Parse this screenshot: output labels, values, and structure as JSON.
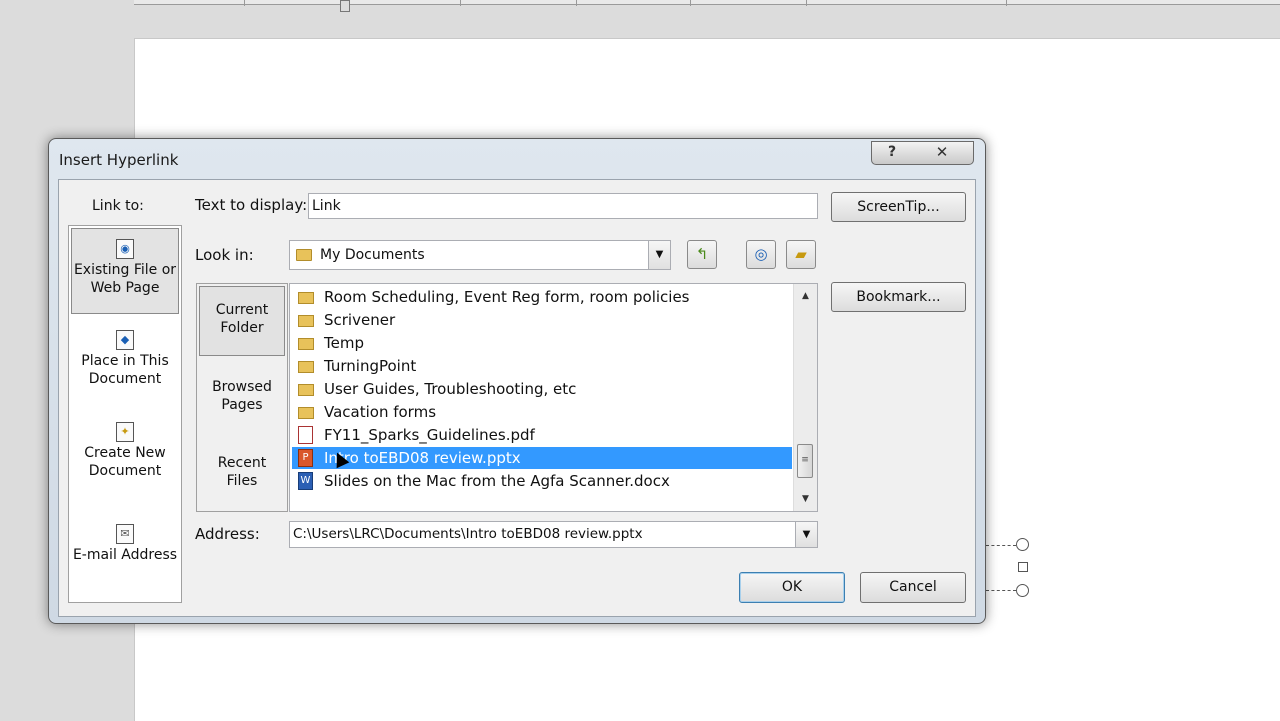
{
  "dialog": {
    "title": "Insert Hyperlink",
    "help_glyph": "?",
    "close_glyph": "✕"
  },
  "linkto": {
    "label": "Link to:",
    "items": [
      {
        "label_line1": "Existing File or",
        "label_line2": "Web Page"
      },
      {
        "label_line1": "Place in This",
        "label_line2": "Document"
      },
      {
        "label_line1": "Create New",
        "label_line2": "Document"
      },
      {
        "label_line1": "E-mail Address",
        "label_line2": ""
      }
    ]
  },
  "text_to_display": {
    "label": "Text to display:",
    "value": "Link"
  },
  "buttons": {
    "screentip": "ScreenTip...",
    "bookmark": "Bookmark...",
    "ok": "OK",
    "cancel": "Cancel"
  },
  "look_in": {
    "label": "Look in:",
    "value": "My Documents"
  },
  "nav": {
    "items": [
      {
        "line1": "Current",
        "line2": "Folder"
      },
      {
        "line1": "Browsed",
        "line2": "Pages"
      },
      {
        "line1": "Recent",
        "line2": "Files"
      }
    ]
  },
  "files": [
    {
      "name": "Room Scheduling, Event Reg form, room policies",
      "type": "folder"
    },
    {
      "name": "Scrivener",
      "type": "folder"
    },
    {
      "name": "Temp",
      "type": "folder"
    },
    {
      "name": "TurningPoint",
      "type": "folder"
    },
    {
      "name": "User Guides, Troubleshooting, etc",
      "type": "folder"
    },
    {
      "name": "Vacation forms",
      "type": "folder"
    },
    {
      "name": "FY11_Sparks_Guidelines.pdf",
      "type": "pdf"
    },
    {
      "name": "Intro toEBD08 review.pptx",
      "type": "pptx",
      "selected": true
    },
    {
      "name": "Slides on the Mac from the Agfa Scanner.docx",
      "type": "docx"
    }
  ],
  "address": {
    "label": "Address:",
    "value": "C:\\Users\\LRC\\Documents\\Intro toEBD08 review.pptx"
  }
}
